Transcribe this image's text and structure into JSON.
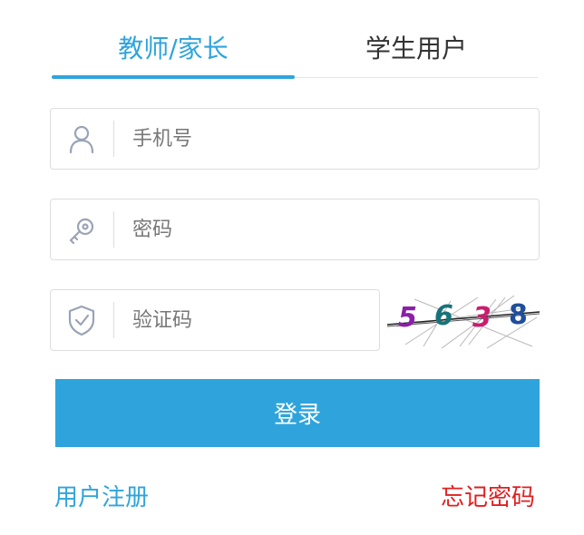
{
  "tabs": [
    {
      "label": "教师/家长",
      "active": true
    },
    {
      "label": "学生用户",
      "active": false
    }
  ],
  "fields": {
    "phone": {
      "placeholder": "手机号",
      "value": "",
      "icon": "user-icon"
    },
    "password": {
      "placeholder": "密码",
      "value": "",
      "icon": "key-icon"
    },
    "captcha": {
      "placeholder": "验证码",
      "value": "",
      "icon": "shield-check-icon"
    }
  },
  "captcha_image": {
    "digits": [
      "5",
      "6",
      "3",
      "8"
    ]
  },
  "login_button": {
    "label": "登录"
  },
  "links": {
    "register": "用户注册",
    "forgot_password": "忘记密码"
  },
  "colors": {
    "accent": "#2fa4dc",
    "forgot": "#e02020",
    "border": "#dddddd",
    "icon": "#9aa3b5"
  }
}
